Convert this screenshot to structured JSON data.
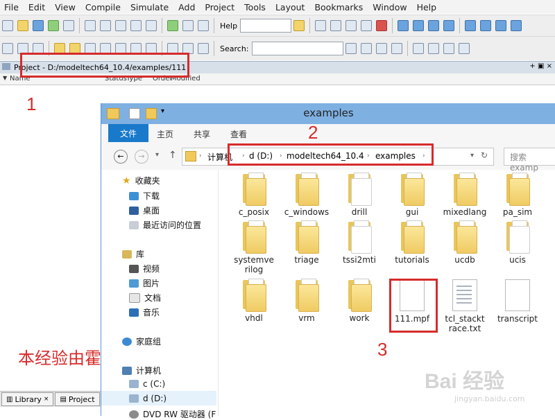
{
  "modelsim": {
    "menu": [
      "File",
      "Edit",
      "View",
      "Compile",
      "Simulate",
      "Add",
      "Project",
      "Tools",
      "Layout",
      "Bookmarks",
      "Window",
      "Help"
    ],
    "toolbar": {
      "help_label": "Help",
      "search_label": "Search:"
    },
    "project_title": "Project - D:/modeltech64_10.4/examples/111",
    "columns": [
      "Name",
      "Status",
      "Type",
      "Order",
      "Modified"
    ],
    "bottom_tabs": [
      "Library",
      "Project"
    ]
  },
  "annotations": {
    "one": "1",
    "two": "2",
    "three": "3",
    "credit": "本经验由霍团长原创"
  },
  "explorer": {
    "title": "examples",
    "ribbon_tabs": [
      "文件",
      "主页",
      "共享",
      "查看"
    ],
    "address": [
      "计算机",
      "d (D:)",
      "modeltech64_10.4",
      "examples"
    ],
    "search_placeholder": "搜索 examp",
    "nav": {
      "favorites": "收藏夹",
      "fav_items": [
        "下载",
        "桌面",
        "最近访问的位置"
      ],
      "library": "库",
      "lib_items": [
        "视频",
        "图片",
        "文档",
        "音乐"
      ],
      "homegroup": "家庭组",
      "computer": "计算机",
      "drives": [
        "c (C:)",
        "d (D:)",
        "DVD RW 驱动器 (F"
      ]
    },
    "items": [
      {
        "name": "c_posix",
        "kind": "folder"
      },
      {
        "name": "c_windows",
        "kind": "folder"
      },
      {
        "name": "drill",
        "kind": "folder-empty"
      },
      {
        "name": "gui",
        "kind": "folder"
      },
      {
        "name": "mixedlang",
        "kind": "folder"
      },
      {
        "name": "pa_sim",
        "kind": "folder"
      },
      {
        "name": "systemverilog",
        "kind": "folder"
      },
      {
        "name": "triage",
        "kind": "folder"
      },
      {
        "name": "tssi2mti",
        "kind": "folder-empty"
      },
      {
        "name": "tutorials",
        "kind": "folder"
      },
      {
        "name": "ucdb",
        "kind": "folder"
      },
      {
        "name": "ucis",
        "kind": "folder-empty"
      },
      {
        "name": "vhdl",
        "kind": "folder"
      },
      {
        "name": "vrm",
        "kind": "folder"
      },
      {
        "name": "work",
        "kind": "folder"
      },
      {
        "name": "111.mpf",
        "kind": "file"
      },
      {
        "name": "tcl_stacktrace.txt",
        "kind": "text"
      },
      {
        "name": "transcript",
        "kind": "file"
      }
    ]
  },
  "watermark": {
    "brand": "Bai 经验",
    "url": "jingyan.baidu.com"
  }
}
